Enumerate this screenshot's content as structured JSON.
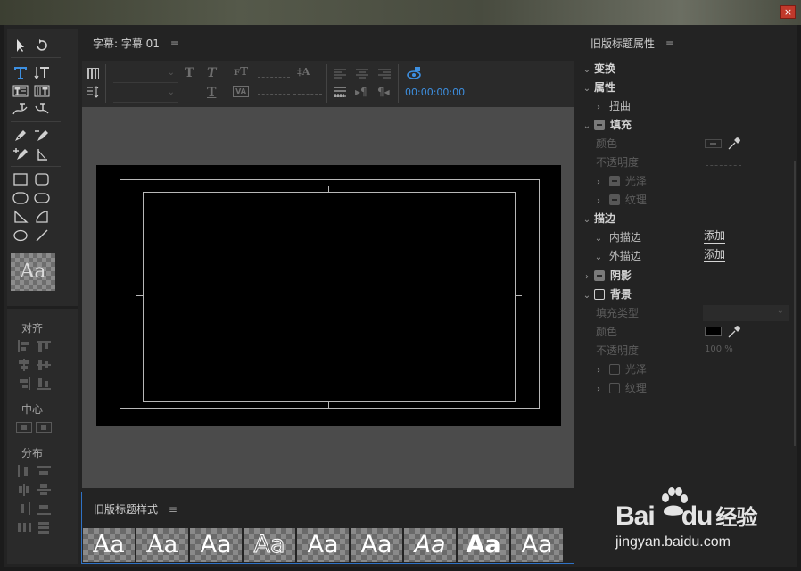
{
  "window": {
    "close_label": "×"
  },
  "tools": {
    "align_label": "对齐",
    "center_label": "中心",
    "distribute_label": "分布",
    "style_preview": "Aa"
  },
  "editor": {
    "tab_label": "字幕: 字幕 01",
    "menu_glyph": "≡",
    "timecode": "00:00:00:00"
  },
  "styles_panel": {
    "title": "旧版标题样式",
    "menu_glyph": "≡",
    "swatches": [
      "Aa",
      "Aa",
      "Aa",
      "Aa",
      "Aa",
      "Aa",
      "Aa",
      "Aa",
      "Aa"
    ]
  },
  "props": {
    "title": "旧版标题属性",
    "menu_glyph": "≡",
    "transform": "变换",
    "attributes": "属性",
    "distort": "扭曲",
    "fill": "填充",
    "fill_color": "颜色",
    "fill_opacity": "不透明度",
    "sheen": "光泽",
    "texture": "纹理",
    "stroke": "描边",
    "inner_stroke": "内描边",
    "outer_stroke": "外描边",
    "add_inner": "添加",
    "add_outer": "添加",
    "shadow": "阴影",
    "background": "背景",
    "bg_fill_type": "填充类型",
    "bg_color": "颜色",
    "bg_opacity": "不透明度",
    "bg_opacity_value": "100 %",
    "bg_sheen": "光泽",
    "bg_texture": "纹理"
  },
  "watermark": {
    "brand_left": "Bai",
    "brand_right": "du",
    "brand_cn": "经验",
    "url": "jingyan.baidu.com"
  },
  "colors": {
    "accent": "#2f72c5",
    "timecode": "#3d8fe0",
    "close": "#c1392b"
  }
}
